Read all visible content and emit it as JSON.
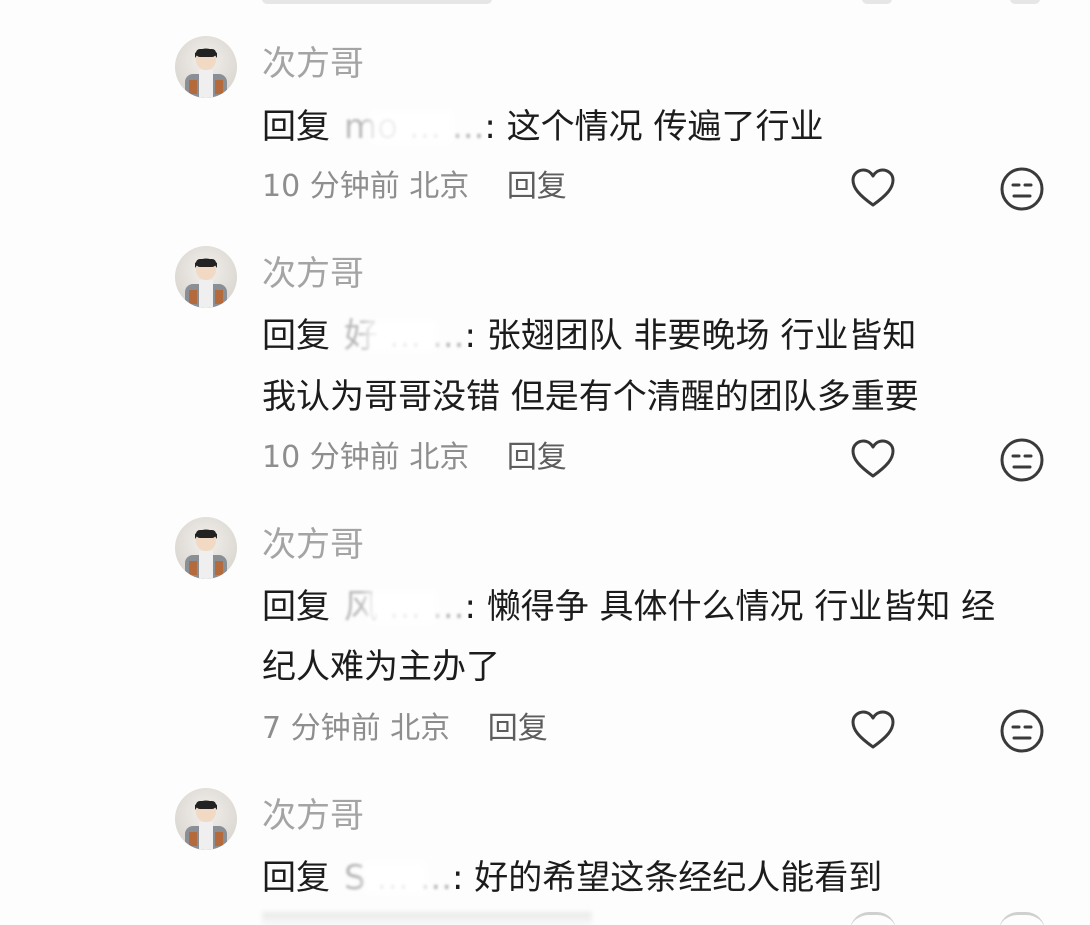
{
  "comments": [
    {
      "username": "次方哥",
      "reply_prefix": "回复",
      "mention": "mo ... ...",
      "lines": [
        ": 这个情况 传遍了行业"
      ],
      "time": "10 分钟前",
      "location": "北京",
      "reply_action": "回复"
    },
    {
      "username": "次方哥",
      "reply_prefix": "回复",
      "mention": "好 ... ...",
      "lines": [
        ": 张翅团队 非要晚场 行业皆知",
        "我认为哥哥没错 但是有个清醒的团队多重要"
      ],
      "time": "10 分钟前",
      "location": "北京",
      "reply_action": "回复"
    },
    {
      "username": "次方哥",
      "reply_prefix": "回复",
      "mention": "风 ... ...",
      "lines": [
        ": 懒得争 具体什么情况 行业皆知 经",
        "纪人难为主办了"
      ],
      "time": "7 分钟前",
      "location": "北京",
      "reply_action": "回复"
    },
    {
      "username": "次方哥",
      "reply_prefix": "回复",
      "mention": "S ... ...",
      "lines": [
        ": 好的希望这条经纪人能看到"
      ],
      "time": "",
      "location": "",
      "reply_action": ""
    }
  ],
  "icons": {
    "like": "heart-outline-icon",
    "dislike": "meh-face-icon"
  },
  "colors": {
    "username": "#a4a4a4",
    "body_text": "#1c1c1c",
    "meta_text": "#8e8e8e",
    "icon_stroke": "#3a3a3a"
  }
}
